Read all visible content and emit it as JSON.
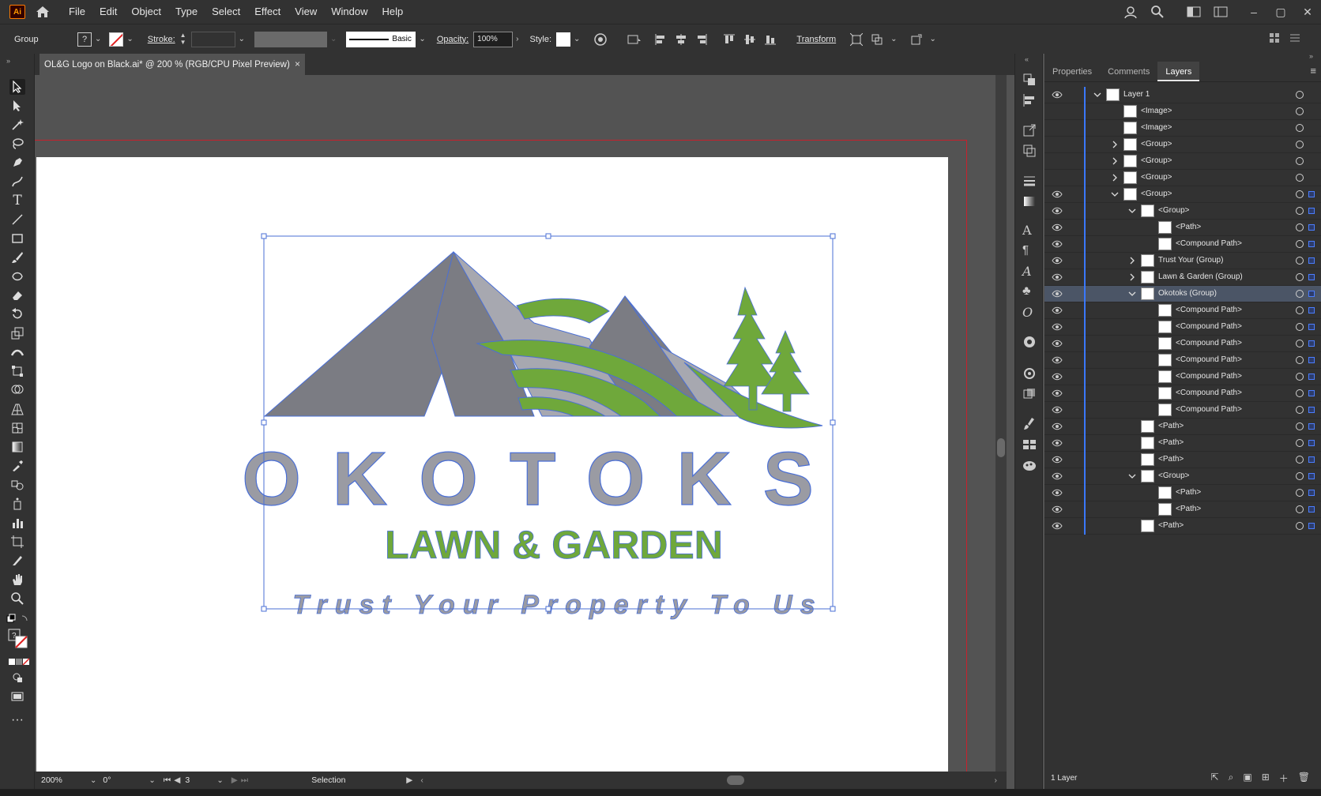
{
  "app": {
    "logo": "Ai",
    "brand_color": "#ff9a00"
  },
  "menu": [
    "File",
    "Edit",
    "Object",
    "Type",
    "Select",
    "Effect",
    "View",
    "Window",
    "Help"
  ],
  "control": {
    "selection_type": "Group",
    "stroke_label": "Stroke:",
    "brush_label": "Basic",
    "opacity_label": "Opacity:",
    "opacity_value": "100%",
    "style_label": "Style:",
    "transform_label": "Transform"
  },
  "document": {
    "tab_title": "OL&G Logo on Black.ai* @ 200 % (RGB/CPU Pixel Preview)",
    "close": "×"
  },
  "logo_text": {
    "okotoks": "OKOTOKS",
    "lawn_garden": "LAWN & GARDEN",
    "tagline": "Trust Your Property To Us"
  },
  "colors": {
    "gray": "#9a9ba3",
    "dark_gray": "#7b7c83",
    "light_gray": "#a7a8b0",
    "green": "#6fa83b",
    "outline": "#4a6fd6"
  },
  "status": {
    "zoom": "200%",
    "rotation": "0°",
    "artboard": "3",
    "tool": "Selection"
  },
  "panel": {
    "tabs": [
      "Properties",
      "Comments",
      "Layers"
    ],
    "active_tab": "Layers",
    "footer_label": "1 Layer",
    "layers": [
      {
        "name": "Layer 1",
        "indent": 0,
        "twirl": "down",
        "eye": true,
        "target": false
      },
      {
        "name": "<Image>",
        "indent": 1,
        "twirl": "",
        "eye": false
      },
      {
        "name": "<Image>",
        "indent": 1,
        "twirl": "",
        "eye": false
      },
      {
        "name": "<Group>",
        "indent": 1,
        "twirl": "right",
        "eye": false
      },
      {
        "name": "<Group>",
        "indent": 1,
        "twirl": "right",
        "eye": false
      },
      {
        "name": "<Group>",
        "indent": 1,
        "twirl": "right",
        "eye": false
      },
      {
        "name": "<Group>",
        "indent": 1,
        "twirl": "down",
        "eye": true,
        "sel": true
      },
      {
        "name": "<Group>",
        "indent": 2,
        "twirl": "down",
        "eye": true,
        "sel": true
      },
      {
        "name": "<Path>",
        "indent": 3,
        "twirl": "",
        "eye": true,
        "sel": true
      },
      {
        "name": "<Compound Path>",
        "indent": 3,
        "twirl": "",
        "eye": true,
        "sel": true
      },
      {
        "name": "Trust Your (Group)",
        "indent": 2,
        "twirl": "right",
        "eye": true,
        "sel": true
      },
      {
        "name": "Lawn & Garden (Group)",
        "indent": 2,
        "twirl": "right",
        "eye": true,
        "sel": true
      },
      {
        "name": "Okotoks (Group)",
        "indent": 2,
        "twirl": "down",
        "eye": true,
        "sel": true,
        "highlight": true
      },
      {
        "name": "<Compound Path>",
        "indent": 3,
        "twirl": "",
        "eye": true,
        "sel": true
      },
      {
        "name": "<Compound Path>",
        "indent": 3,
        "twirl": "",
        "eye": true,
        "sel": true
      },
      {
        "name": "<Compound Path>",
        "indent": 3,
        "twirl": "",
        "eye": true,
        "sel": true
      },
      {
        "name": "<Compound Path>",
        "indent": 3,
        "twirl": "",
        "eye": true,
        "sel": true
      },
      {
        "name": "<Compound Path>",
        "indent": 3,
        "twirl": "",
        "eye": true,
        "sel": true
      },
      {
        "name": "<Compound Path>",
        "indent": 3,
        "twirl": "",
        "eye": true,
        "sel": true
      },
      {
        "name": "<Compound Path>",
        "indent": 3,
        "twirl": "",
        "eye": true,
        "sel": true
      },
      {
        "name": "<Path>",
        "indent": 2,
        "twirl": "",
        "eye": true,
        "sel": true
      },
      {
        "name": "<Path>",
        "indent": 2,
        "twirl": "",
        "eye": true,
        "sel": true
      },
      {
        "name": "<Path>",
        "indent": 2,
        "twirl": "",
        "eye": true,
        "sel": true
      },
      {
        "name": "<Group>",
        "indent": 2,
        "twirl": "down",
        "eye": true,
        "sel": true
      },
      {
        "name": "<Path>",
        "indent": 3,
        "twirl": "",
        "eye": true,
        "sel": true
      },
      {
        "name": "<Path>",
        "indent": 3,
        "twirl": "",
        "eye": true,
        "sel": true
      },
      {
        "name": "<Path>",
        "indent": 2,
        "twirl": "",
        "eye": true,
        "sel": true
      }
    ]
  },
  "icons": [
    "home-icon",
    "search-icon",
    "user-icon",
    "selection-tool-icon",
    "direct-selection-icon",
    "eye-icon",
    "layer-thumbnail-icon"
  ]
}
